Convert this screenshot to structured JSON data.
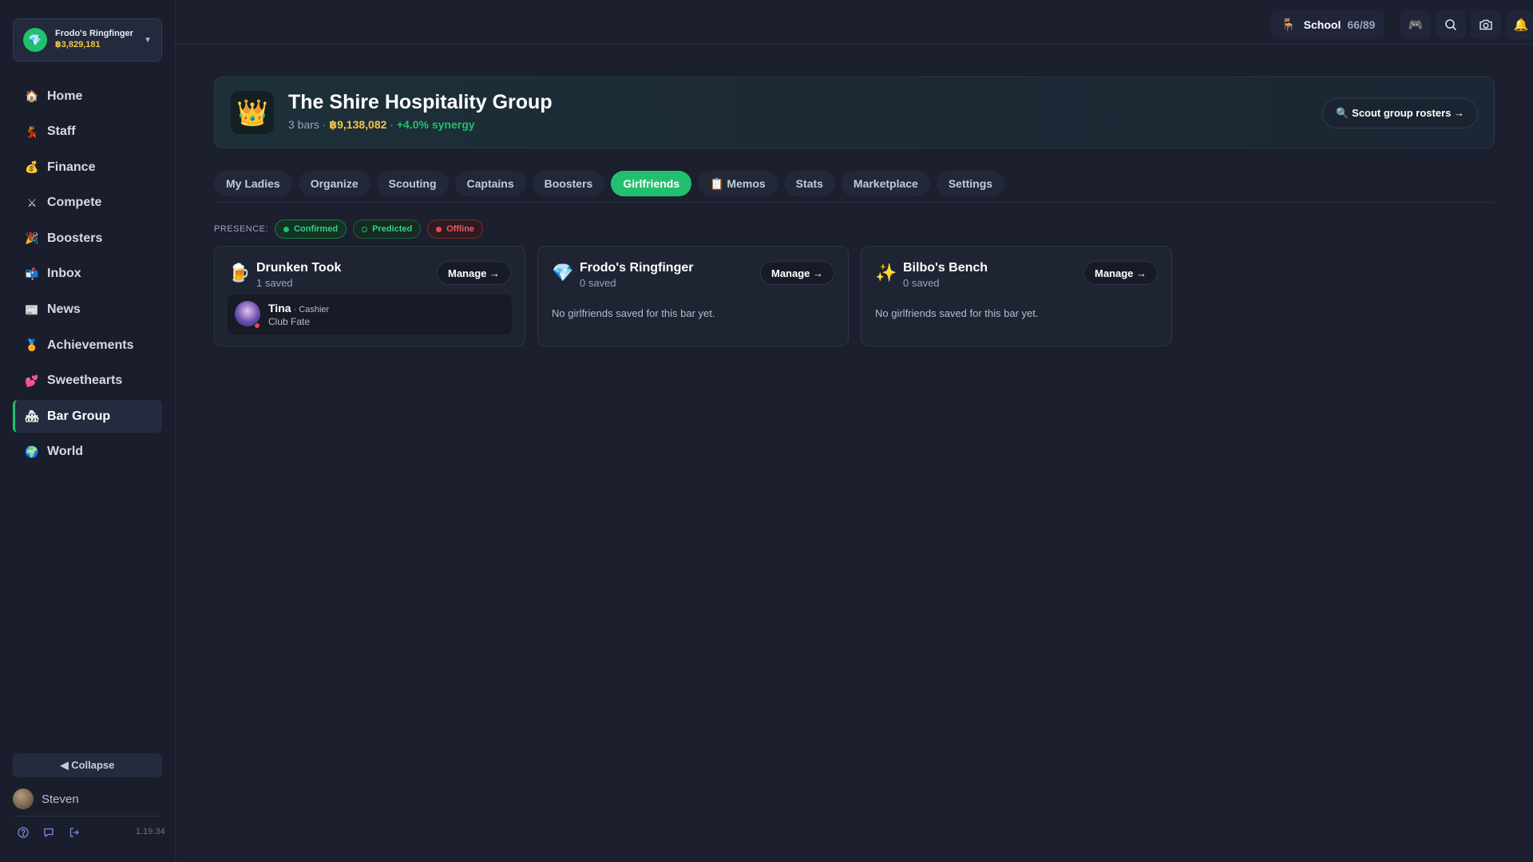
{
  "bar_switcher": {
    "name": "Frodo's Ringfinger",
    "money": "฿3,829,181",
    "gem_icon": "gem-icon"
  },
  "nav": [
    {
      "icon": "🏠",
      "label": "Home"
    },
    {
      "icon": "💃",
      "label": "Staff"
    },
    {
      "icon": "💰",
      "label": "Finance"
    },
    {
      "icon": "⚔",
      "label": "Compete"
    },
    {
      "icon": "🎉",
      "label": "Boosters"
    },
    {
      "icon": "📬",
      "label": "Inbox"
    },
    {
      "icon": "📰",
      "label": "News"
    },
    {
      "icon": "🏅",
      "label": "Achievements"
    },
    {
      "icon": "💕",
      "label": "Sweethearts"
    },
    {
      "icon": "🏘",
      "label": "Bar Group"
    },
    {
      "icon": "🌍",
      "label": "World"
    }
  ],
  "active_nav": "Bar Group",
  "sidebar_footer": {
    "collapse_label": "◀ Collapse",
    "user_name": "Steven",
    "version": "1.19.34"
  },
  "topbar": {
    "school_label": "School",
    "school_count": "66/89"
  },
  "group": {
    "title": "The Shire Hospitality Group",
    "bars": "3 bars",
    "sep1": " · ",
    "value": "฿9,138,082",
    "sep2": " · ",
    "synergy": "+4.0% synergy",
    "scout_label": "🔍 Scout group rosters →"
  },
  "tabs": [
    "My Ladies",
    "Organize",
    "Scouting",
    "Captains",
    "Boosters",
    "Girlfriends",
    "📋 Memos",
    "Stats",
    "Marketplace",
    "Settings"
  ],
  "active_tab": "Girlfriends",
  "presence": {
    "label": "PRESENCE:",
    "confirmed": "Confirmed",
    "predicted": "Predicted",
    "offline": "Offline"
  },
  "bars": [
    {
      "icon": "🍺",
      "name": "Drunken Took",
      "saved": "1 saved",
      "manage": "Manage →",
      "girlfriend": {
        "name": "Tina",
        "role": " · Cashier",
        "club": "Club Fate"
      }
    },
    {
      "icon": "💎",
      "name": "Frodo's Ringfinger",
      "saved": "0 saved",
      "manage": "Manage →",
      "empty": "No girlfriends saved for this bar yet."
    },
    {
      "icon": "✨",
      "name": "Bilbo's Bench",
      "saved": "0 saved",
      "manage": "Manage →",
      "empty": "No girlfriends saved for this bar yet."
    }
  ],
  "colors": {
    "accent": "#22c06e",
    "gold": "#f5c542",
    "offline": "#e5484d",
    "bg": "#1b1f2e"
  }
}
